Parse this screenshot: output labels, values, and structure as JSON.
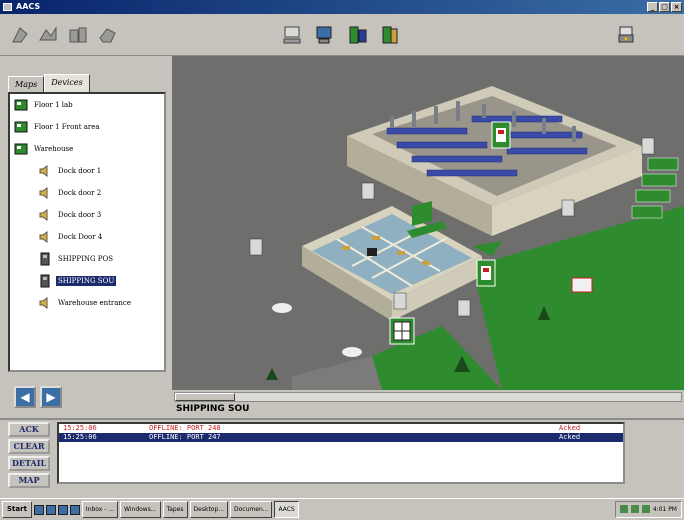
{
  "window": {
    "title": "AACS"
  },
  "tabs": {
    "maps": "Maps",
    "devices": "Devices"
  },
  "tree": [
    {
      "label": "Floor 1 lab",
      "type": "floor"
    },
    {
      "label": "Floor 1 Front area",
      "type": "floor"
    },
    {
      "label": "Warehouse",
      "type": "floor"
    },
    {
      "label": "Dock door 1",
      "type": "speaker"
    },
    {
      "label": "Dock door 2",
      "type": "speaker"
    },
    {
      "label": "Dock door 3",
      "type": "speaker"
    },
    {
      "label": "Dock Door 4",
      "type": "speaker"
    },
    {
      "label": "SHIPPING POS",
      "type": "reader"
    },
    {
      "label": "SHIPPING SOU",
      "type": "reader",
      "selected": true
    },
    {
      "label": "Warehouse entrance",
      "type": "speaker"
    }
  ],
  "map": {
    "status_label": "SHIPPING SOU"
  },
  "alarm_buttons": {
    "ack": "ACK",
    "clear": "CLEAR",
    "detail": "DETAIL",
    "map": "MAP"
  },
  "alarms": [
    {
      "time": "15:25:06",
      "message": "OFFLINE: PORT 248",
      "status": "Acked"
    },
    {
      "time": "15:25:06",
      "message": "OFFLINE: PORT 247",
      "status": "Acked"
    }
  ],
  "taskbar": {
    "start": "Start",
    "tasks": [
      "Inbox - ...",
      "Windows...",
      "Tapes",
      "Desktop...",
      "Documen...",
      "AACS"
    ],
    "clock": "4:01 PM"
  },
  "colors": {
    "accent": "#1c2a6e",
    "alarm": "#c81e1e",
    "grass": "#2e8b2e",
    "shelving": "#3a4aa8"
  }
}
